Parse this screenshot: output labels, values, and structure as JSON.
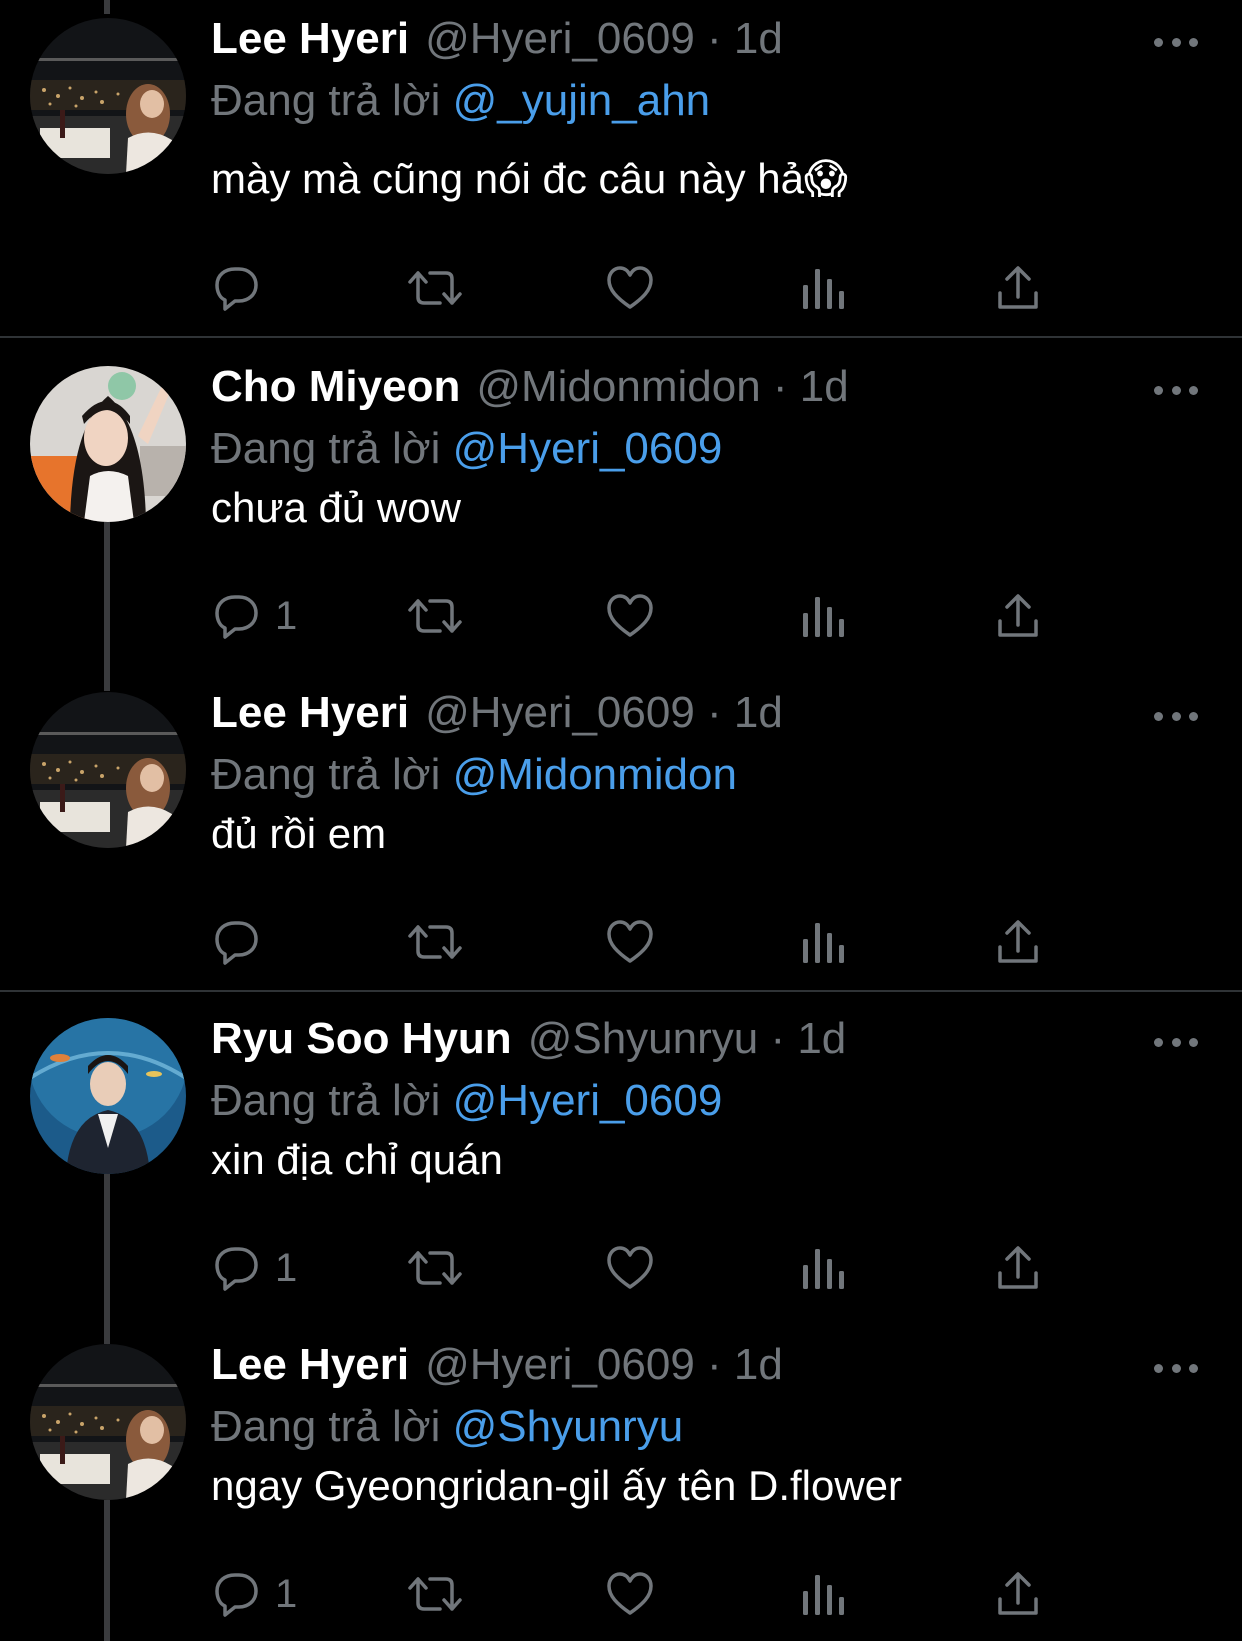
{
  "colors": {
    "background": "#000000",
    "name": "#ffffff",
    "secondary": "#71767b",
    "mention": "#4a9eea",
    "divider": "#2f3336"
  },
  "tweets": [
    {
      "name": "Lee Hyeri",
      "meta": "@Hyeri_0609 · 1d",
      "reply_prefix": "Đang trả lời",
      "reply_to": "@_yujin_ahn",
      "text": "mày mà cũng nói đc câu này hả😱",
      "reply_count": "",
      "avatar": "night-city-avatar"
    },
    {
      "name": "Cho Miyeon",
      "meta": "@Midonmidon · 1d",
      "reply_prefix": "Đang trả lời",
      "reply_to": "@Hyeri_0609",
      "text": "chưa đủ wow",
      "reply_count": "1",
      "avatar": "portrait-avatar"
    },
    {
      "name": "Lee Hyeri",
      "meta": "@Hyeri_0609 · 1d",
      "reply_prefix": "Đang trả lời",
      "reply_to": "@Midonmidon",
      "text": "đủ rồi em",
      "reply_count": "",
      "avatar": "night-city-avatar"
    },
    {
      "name": "Ryu Soo Hyun",
      "meta": "@Shyunryu · 1d",
      "reply_prefix": "Đang trả lời",
      "reply_to": "@Hyeri_0609",
      "text": "xin địa chỉ quán",
      "reply_count": "1",
      "avatar": "aquarium-avatar"
    },
    {
      "name": "Lee Hyeri",
      "meta": "@Hyeri_0609 · 1d",
      "reply_prefix": "Đang trả lời",
      "reply_to": "@Shyunryu",
      "text": "ngay Gyeongridan-gil ấy tên D.flower",
      "reply_count": "1",
      "avatar": "night-city-avatar"
    }
  ],
  "icons": {
    "reply": "reply-icon",
    "retweet": "retweet-icon",
    "like": "heart-icon",
    "views": "views-icon",
    "share": "share-icon",
    "more": "more-icon"
  }
}
